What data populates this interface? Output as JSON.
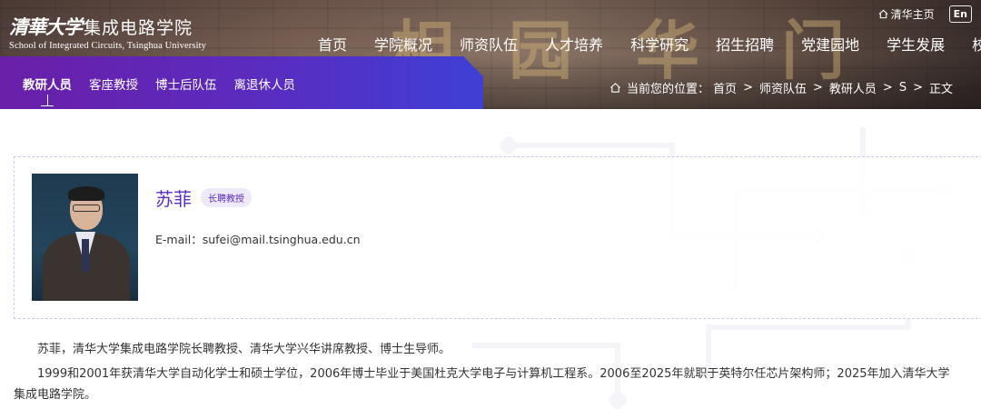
{
  "logo": {
    "cn_university": "清華大学",
    "cn_school": "集成电路学院",
    "en": "School of Integrated Circuits, Tsinghua University"
  },
  "top_links": {
    "home": "清华主页",
    "lang": "En"
  },
  "main_nav": [
    "首页",
    "学院概况",
    "师资队伍",
    "人才培养",
    "科学研究",
    "招生招聘",
    "党建园地",
    "学生发展",
    "校友"
  ],
  "subnav": [
    "教研人员",
    "客座教授",
    "博士后队伍",
    "离退休人员"
  ],
  "breadcrumb": {
    "label": "当前您的位置：",
    "items": [
      "首页",
      "师资队伍",
      "教研人员",
      "S",
      "正文"
    ]
  },
  "profile": {
    "name": "苏菲",
    "title_badge": "长聘教授",
    "email_label": "E-mail：",
    "email": "sufei@mail.tsinghua.edu.cn"
  },
  "bio": [
    "苏菲，清华大学集成电路学院长聘教授、清华大学兴华讲席教授、博士生导师。",
    "1999和2001年获清华大学自动化学士和硕士学位，2006年博士毕业于美国杜克大学电子与计算机工程系。2006至2025年就职于英特尔任芯片架构师；2025年加入清华大学集成电路学院。"
  ],
  "colors": {
    "accent": "#5a2cc0",
    "subnav_gradient_start": "#6a1fa8",
    "subnav_gradient_end": "#3f3fd6"
  }
}
